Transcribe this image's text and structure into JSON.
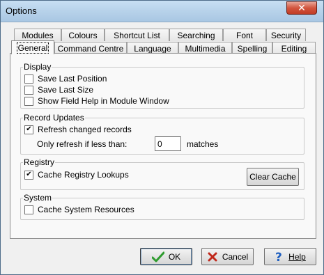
{
  "window": {
    "title": "Options",
    "close_glyph": "✕"
  },
  "tabs_back": [
    {
      "label": "Modules"
    },
    {
      "label": "Colours"
    },
    {
      "label": "Shortcut List"
    },
    {
      "label": "Searching"
    },
    {
      "label": "Font"
    },
    {
      "label": "Security"
    }
  ],
  "tabs_front": [
    {
      "label": "General",
      "selected": true
    },
    {
      "label": "Command Centre"
    },
    {
      "label": "Language"
    },
    {
      "label": "Multimedia"
    },
    {
      "label": "Spelling"
    },
    {
      "label": "Editing"
    }
  ],
  "display": {
    "title": "Display",
    "options": [
      {
        "label": "Save Last Position",
        "checked": false
      },
      {
        "label": "Save Last Size",
        "checked": false
      },
      {
        "label": "Show Field Help in Module Window",
        "checked": false
      }
    ]
  },
  "record_updates": {
    "title": "Record Updates",
    "refresh": {
      "label": "Refresh changed records",
      "checked": true
    },
    "only_refresh_label": "Only refresh if less than:",
    "matches_value": "0",
    "matches_suffix": "matches"
  },
  "registry": {
    "title": "Registry",
    "cache": {
      "label": "Cache Registry Lookups",
      "checked": true
    },
    "clear_button": "Clear Cache"
  },
  "system": {
    "title": "System",
    "cache": {
      "label": "Cache System Resources",
      "checked": false
    }
  },
  "buttons": {
    "ok": "OK",
    "cancel": "Cancel",
    "help": "Help"
  },
  "colors": {
    "ok_icon": "#2e9b2e",
    "cancel_icon": "#c0281b",
    "help_icon": "#1f5fbf"
  }
}
